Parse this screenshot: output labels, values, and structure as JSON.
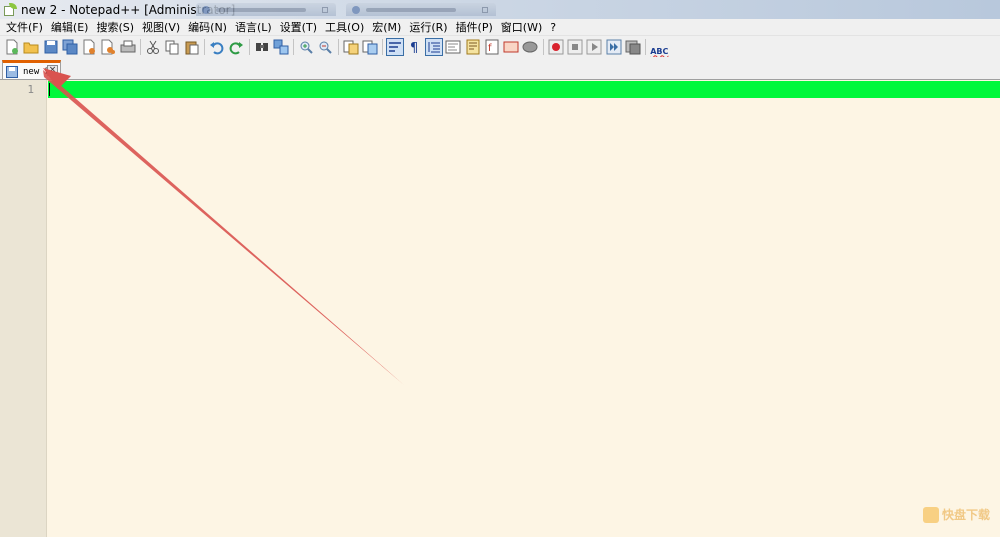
{
  "window": {
    "title": "new 2 - Notepad++ [Administrator]"
  },
  "menu": [
    {
      "label": "文件(F)"
    },
    {
      "label": "编辑(E)"
    },
    {
      "label": "搜索(S)"
    },
    {
      "label": "视图(V)"
    },
    {
      "label": "编码(N)"
    },
    {
      "label": "语言(L)"
    },
    {
      "label": "设置(T)"
    },
    {
      "label": "工具(O)"
    },
    {
      "label": "宏(M)"
    },
    {
      "label": "运行(R)"
    },
    {
      "label": "插件(P)"
    },
    {
      "label": "窗口(W)"
    },
    {
      "label": "?"
    }
  ],
  "toolbar": {
    "spellcheck_label": "ABC"
  },
  "tab": {
    "label": "new 2"
  },
  "editor": {
    "line_number": "1",
    "current_line_color": "#00f83c",
    "background_color": "#fdf5e4"
  },
  "annotation": {
    "arrow_color": "#d9534f"
  },
  "watermark": {
    "text": "快盘下载"
  }
}
